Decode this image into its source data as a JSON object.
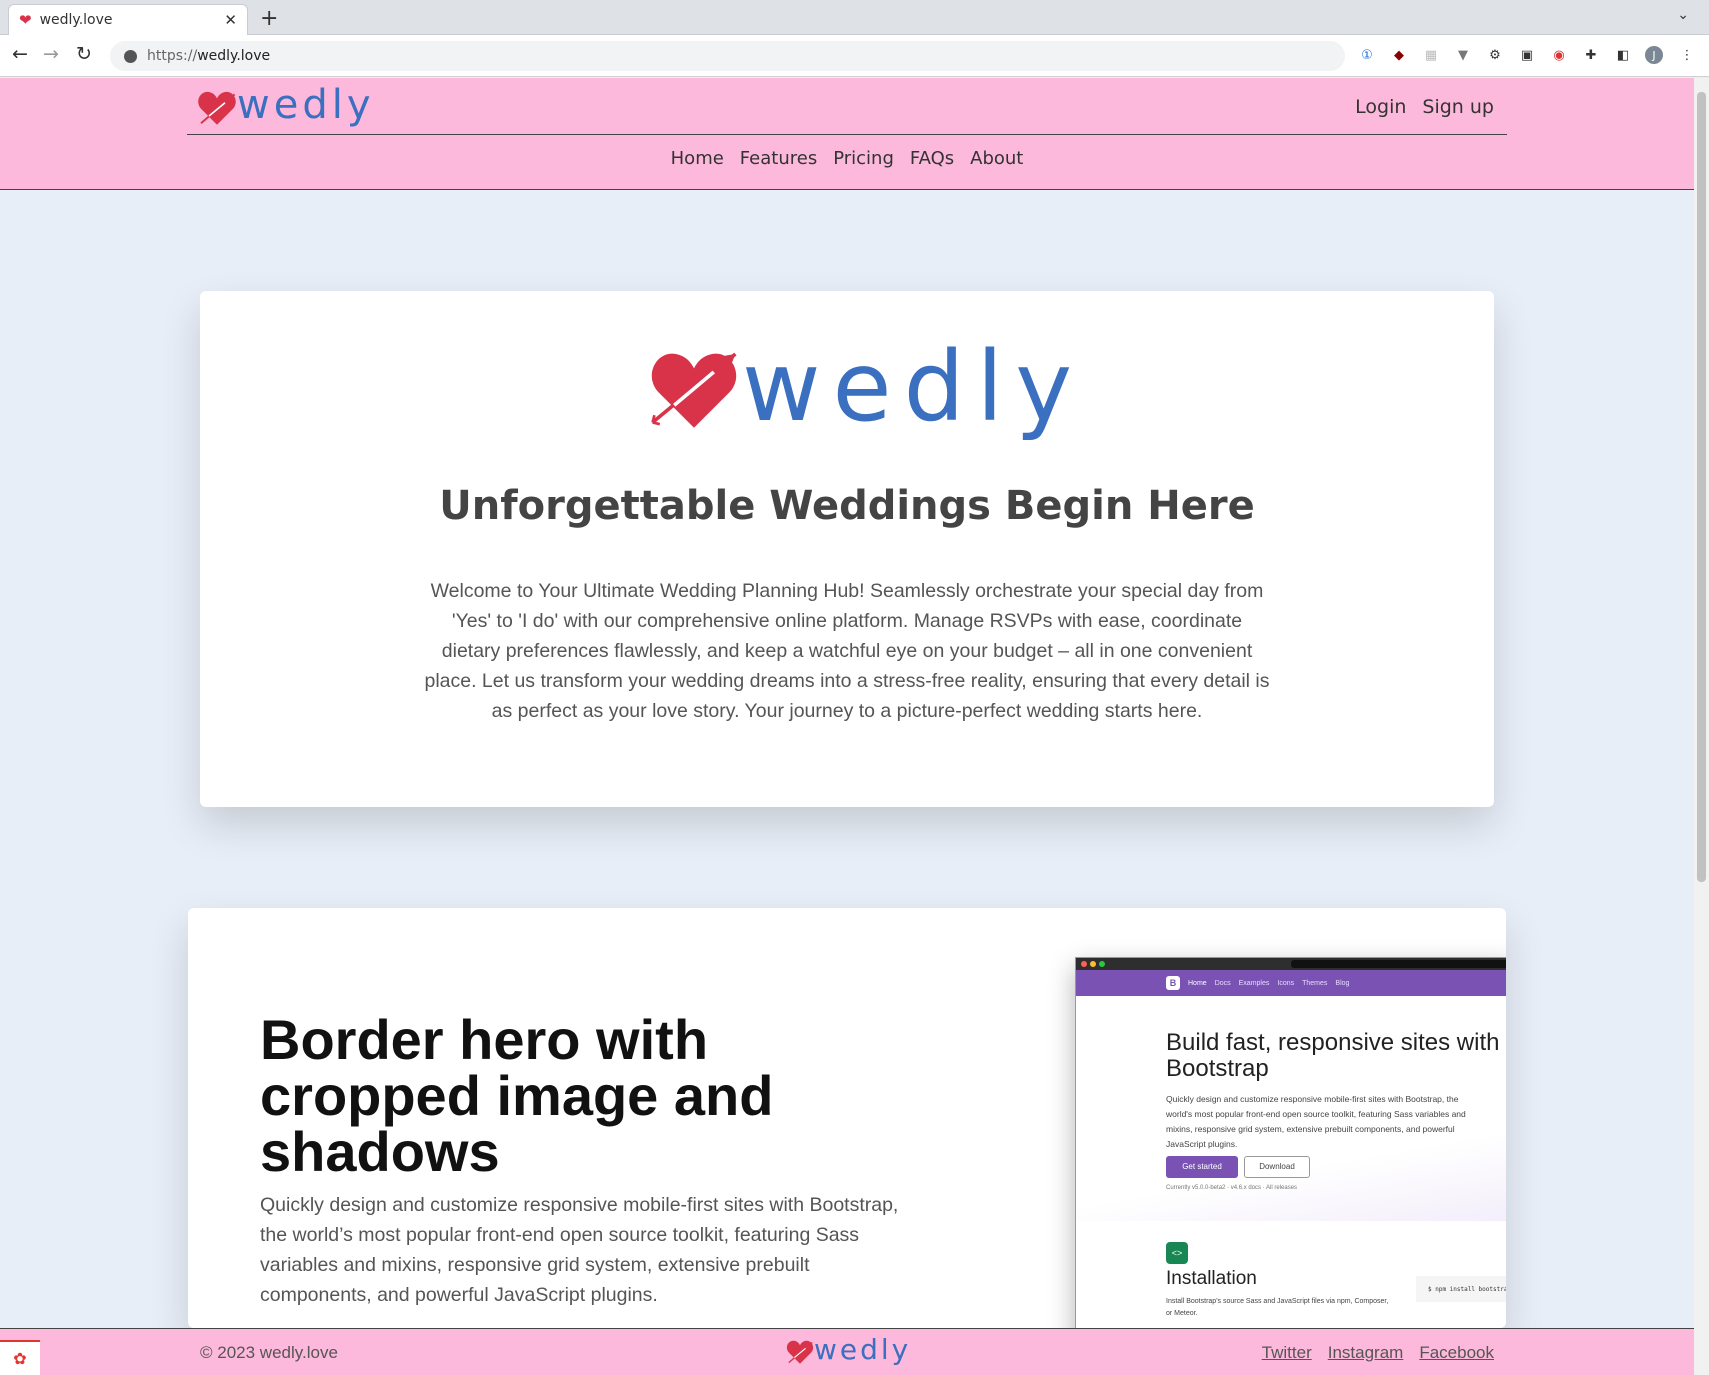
{
  "browser": {
    "tab_title": "wedly.love",
    "url_scheme": "https://",
    "url_host": "wedly.love",
    "avatar_letter": "J"
  },
  "header": {
    "logo_text": "wedly",
    "login": "Login",
    "signup": "Sign up",
    "nav": [
      "Home",
      "Features",
      "Pricing",
      "FAQs",
      "About"
    ]
  },
  "hero": {
    "logo_text": "wedly",
    "title": "Unforgettable Weddings Begin Here",
    "text": "Welcome to Your Ultimate Wedding Planning Hub! Seamlessly orchestrate your special day from 'Yes' to 'I do' with our comprehensive online platform. Manage RSVPs with ease, coordinate dietary preferences flawlessly, and keep a watchful eye on your budget – all in one convenient place. Let us transform your wedding dreams into a stress-free reality, ensuring that every detail is as perfect as your love story. Your journey to a picture-perfect wedding starts here."
  },
  "feature": {
    "title": "Border hero with cropped image and shadows",
    "text": "Quickly design and customize responsive mobile-first sites with Bootstrap, the world’s most popular front-end open source toolkit, featuring Sass variables and mixins, responsive grid system, extensive prebuilt components, and powerful JavaScript plugins.",
    "screenshot": {
      "nav": [
        "Home",
        "Docs",
        "Examples",
        "Icons",
        "Themes",
        "Blog"
      ],
      "headline": "Build fast, responsive sites with Bootstrap",
      "lead": "Quickly design and customize responsive mobile-first sites with Bootstrap, the world's most popular front-end open source toolkit, featuring Sass variables and mixins, responsive grid system, extensive prebuilt components, and powerful JavaScript plugins.",
      "btn_primary": "Get started",
      "btn_secondary": "Download",
      "currently": "Currently v5.0.0-beta2 · v4.6.x docs · All releases",
      "install_title": "Installation",
      "install_text": "Install Bootstrap's source Sass and JavaScript files via npm, Composer, or Meteor.",
      "code": "$ npm install bootstrap"
    }
  },
  "footer": {
    "copyright": "© 2023 wedly.love",
    "logo_text": "wedly",
    "links": [
      "Twitter",
      "Instagram",
      "Facebook"
    ]
  },
  "colors": {
    "pink": "#fdb9dc",
    "brand_blue": "#3b6fc0",
    "heart_red": "#d9334a",
    "page_bg": "#e8eef8",
    "bootstrap_purple": "#7952b3"
  }
}
